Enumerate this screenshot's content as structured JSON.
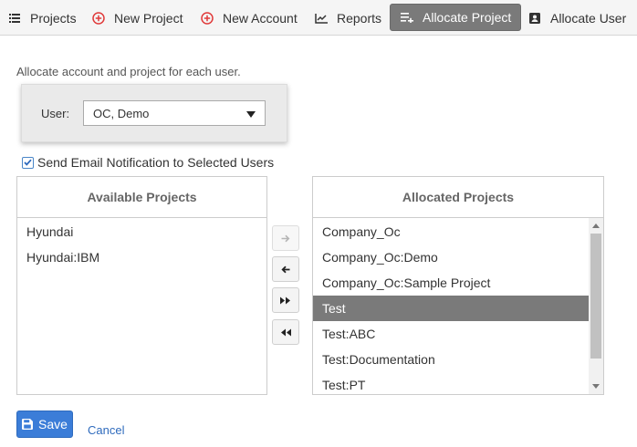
{
  "nav": {
    "items": [
      {
        "label": "Projects",
        "icon": "list-icon"
      },
      {
        "label": "New Project",
        "icon": "plus-circle-icon"
      },
      {
        "label": "New Account",
        "icon": "plus-circle-icon"
      },
      {
        "label": "Reports",
        "icon": "line-chart-icon"
      },
      {
        "label": "Allocate Project",
        "icon": "list-add-icon",
        "active": true
      },
      {
        "label": "Allocate User",
        "icon": "user-card-icon"
      }
    ]
  },
  "intro_text": "Allocate account and project for each user.",
  "user": {
    "label": "User:",
    "selected": "OC, Demo"
  },
  "notify": {
    "label": "Send Email Notification to Selected Users",
    "checked": true
  },
  "available": {
    "header": "Available Projects",
    "items": [
      "Hyundai",
      "Hyundai:IBM"
    ]
  },
  "allocated": {
    "header": "Allocated Projects",
    "items": [
      "Company_Oc",
      "Company_Oc:Demo",
      "Company_Oc:Sample Project",
      "Test",
      "Test:ABC",
      "Test:Documentation",
      "Test:PT"
    ],
    "selected": "Test"
  },
  "buttons": {
    "save": "Save",
    "cancel": "Cancel"
  },
  "colors": {
    "active_tab": "#7a7a7a",
    "accent_red": "#e03a3a",
    "primary": "#3b7dd8",
    "selected_row": "#7a7a7a"
  }
}
